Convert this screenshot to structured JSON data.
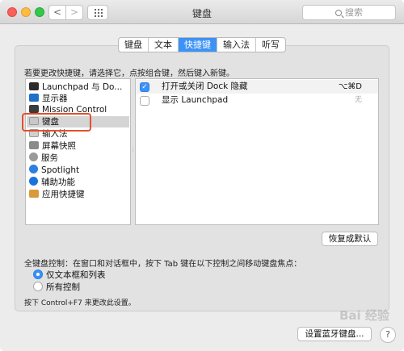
{
  "window": {
    "title": "键盘",
    "search_placeholder": "搜索",
    "nav_back": "<",
    "nav_forward": ">"
  },
  "tabs": [
    {
      "label": "键盘",
      "selected": false
    },
    {
      "label": "文本",
      "selected": false
    },
    {
      "label": "快捷键",
      "selected": true
    },
    {
      "label": "输入法",
      "selected": false
    },
    {
      "label": "听写",
      "selected": false
    }
  ],
  "hint": "若要更改快捷键，请选择它，点按组合键，然后键入新键。",
  "categories": [
    {
      "label": "Launchpad 与 Do...",
      "icon": "launchpad-icon",
      "selected": false
    },
    {
      "label": "显示器",
      "icon": "display-icon",
      "selected": false
    },
    {
      "label": "Mission Control",
      "icon": "mission-control-icon",
      "selected": false
    },
    {
      "label": "键盘",
      "icon": "keyboard-icon",
      "selected": true
    },
    {
      "label": "输入法",
      "icon": "input-method-icon",
      "selected": false
    },
    {
      "label": "屏幕快照",
      "icon": "screenshot-icon",
      "selected": false
    },
    {
      "label": "服务",
      "icon": "gear-icon",
      "selected": false
    },
    {
      "label": "Spotlight",
      "icon": "spotlight-icon",
      "selected": false
    },
    {
      "label": "辅助功能",
      "icon": "accessibility-icon",
      "selected": false
    },
    {
      "label": "应用快捷键",
      "icon": "app-shortcuts-icon",
      "selected": false
    }
  ],
  "shortcuts": [
    {
      "label": "打开或关闭 Dock 隐藏",
      "key": "⌥⌘D",
      "checked": true
    },
    {
      "label": "显示 Launchpad",
      "key": "无",
      "checked": false
    }
  ],
  "buttons": {
    "restore": "恢复成默认",
    "bluetooth": "设置蓝牙键盘...",
    "help": "?"
  },
  "full_keyboard": {
    "label": "全键盘控制：在窗口和对话框中，按下 Tab 键在以下控制之间移动键盘焦点：",
    "options": [
      {
        "label": "仅文本框和列表",
        "selected": true
      },
      {
        "label": "所有控制",
        "selected": false
      }
    ],
    "note": "按下 Control+F7 来更改此设置。"
  },
  "watermark": "Bai 经验",
  "colors": {
    "accent": "#3c92f6",
    "highlight_box": "#e4502f"
  }
}
